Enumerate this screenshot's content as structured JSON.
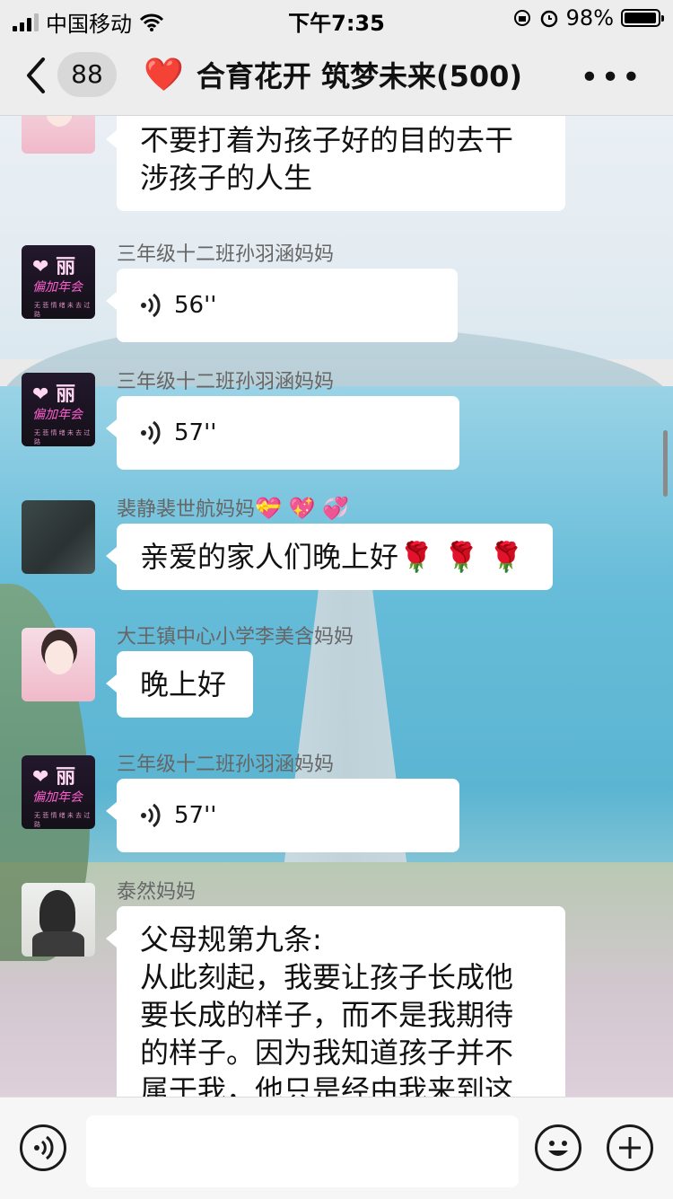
{
  "status_bar": {
    "carrier": "中国移动",
    "time": "下午7:35",
    "battery_percent": "98%",
    "battery_level": 0.98
  },
  "header": {
    "back_count": "88",
    "title": "合育花开 筑梦未来(500)",
    "heart": "❤️",
    "more": "•••"
  },
  "messages": [
    {
      "type": "text",
      "sender": "",
      "lines": [
        "不要打着为孩子好的目的去干",
        "涉孩子的人生"
      ]
    },
    {
      "type": "voice",
      "sender": "三年级十二班孙羽涵妈妈",
      "duration": "56''"
    },
    {
      "type": "voice",
      "sender": "三年级十二班孙羽涵妈妈",
      "duration": "57''"
    },
    {
      "type": "text",
      "sender": "裴静裴世航妈妈",
      "sender_emoji": "💝 💖 💞",
      "text": "亲爱的家人们晚上好🌹 🌹 🌹"
    },
    {
      "type": "text",
      "sender": "大王镇中心小学李美含妈妈",
      "text": "晚上好"
    },
    {
      "type": "voice",
      "sender": "三年级十二班孙羽涵妈妈",
      "duration": "57''"
    },
    {
      "type": "text",
      "sender": "泰然妈妈",
      "lines": [
        "父母规第九条:",
        "从此刻起，我要让孩子长成他",
        "要长成的样子，而不是我期待",
        "的样子。因为我知道孩子并不",
        "属于我，他只是经由我来到这"
      ]
    }
  ],
  "avatar_text": {
    "li_main": "❤ 丽",
    "li_script": "偏加年会",
    "li_small": "无 悲 情 绪   未 去 过 路"
  },
  "input_bar": {
    "placeholder": ""
  },
  "icons": {
    "back": "chevron-left-icon",
    "voice": "voice-icon",
    "emoji": "smiley-icon",
    "plus": "plus-icon"
  }
}
